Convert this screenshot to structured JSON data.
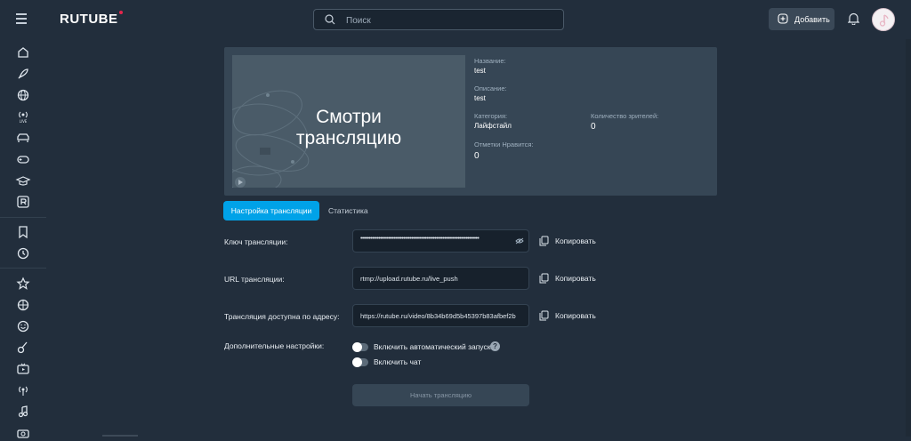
{
  "header": {
    "logo": "RUTUBE",
    "search_placeholder": "Поиск",
    "add_label": "Добавить"
  },
  "sidebar": {
    "items": [
      "home-icon",
      "rocket-icon",
      "globe-icon",
      "live-icon",
      "car-icon",
      "gamepad-icon",
      "graduation-icon",
      "r-logo-icon",
      "bookmark-icon",
      "history-icon",
      "star-icon",
      "basketball-icon",
      "smile-icon",
      "guitar-icon",
      "tv-icon",
      "broadcast-icon",
      "music-icon",
      "camera-icon"
    ]
  },
  "stream": {
    "preview_text": "Смотри трансляцию",
    "name_label": "Название:",
    "name_value": "test",
    "desc_label": "Описание:",
    "desc_value": "test",
    "category_label": "Категория:",
    "category_value": "Лайфстайл",
    "viewers_label": "Количество зрителей:",
    "viewers_value": "0",
    "likes_label": "Отметки Нравится:",
    "likes_value": "0"
  },
  "tabs": {
    "settings": "Настройка трансляции",
    "stats": "Статистика"
  },
  "form": {
    "key_label": "Ключ трансляции:",
    "key_value": "••••••••••••••••••••••••••••••••••••••••••••••••••••••••••••••••••••••••",
    "url_label": "URL трансляции:",
    "url_value": "rtmp://upload.rutube.ru/live_push",
    "addr_label": "Трансляция доступна по адресу:",
    "addr_value": "https://rutube.ru/video/8b34b69d5b45397b83afbef2b",
    "copy_label": "Копировать",
    "extra_label": "Дополнительные настройки:",
    "autostart_label": "Включить автоматический запуск",
    "help": "?",
    "chat_label": "Включить чат",
    "start_button": "Начать трансляцию"
  },
  "colors": {
    "background": "#222e3c",
    "accent": "#00a2e8",
    "card": "#364655",
    "field": "#17212c"
  }
}
